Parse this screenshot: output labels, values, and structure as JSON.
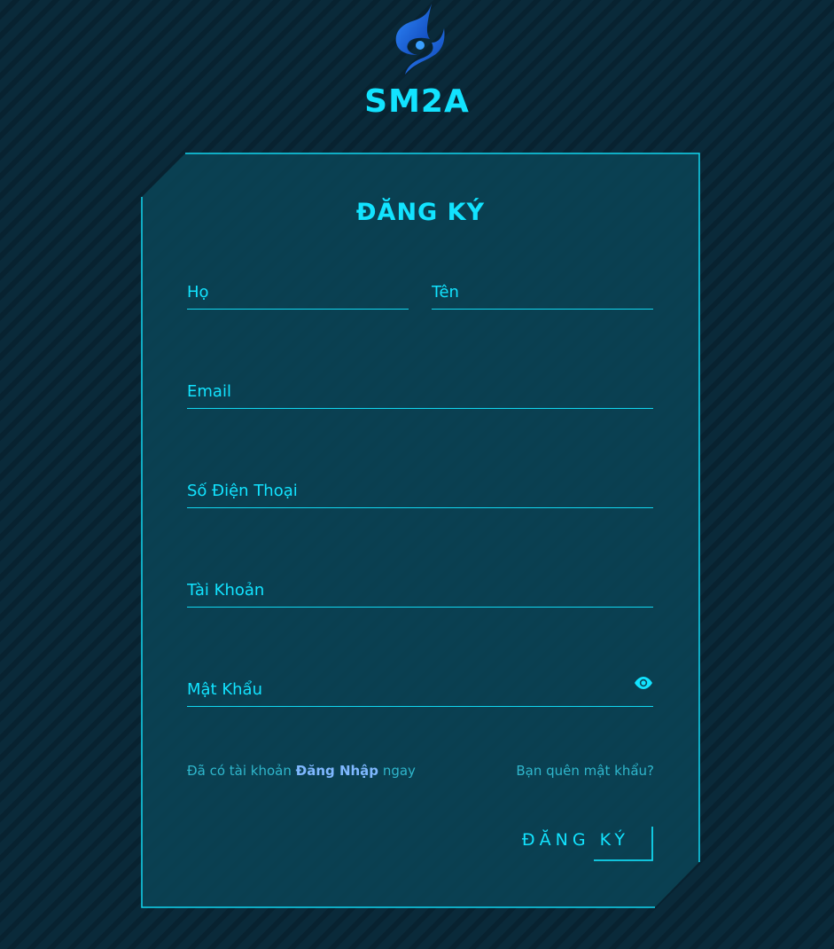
{
  "brand": {
    "name": "SM2A"
  },
  "form": {
    "title": "ĐĂNG KÝ",
    "fields": {
      "last_name": {
        "placeholder": "Họ",
        "value": ""
      },
      "first_name": {
        "placeholder": "Tên",
        "value": ""
      },
      "email": {
        "placeholder": "Email",
        "value": ""
      },
      "phone": {
        "placeholder": "Số Điện Thoại",
        "value": ""
      },
      "username": {
        "placeholder": "Tài Khoản",
        "value": ""
      },
      "password": {
        "placeholder": "Mật Khẩu",
        "value": ""
      }
    },
    "login_prompt": {
      "before": "Đã có tài khoản ",
      "link": "Đăng Nhập",
      "after": " ngay"
    },
    "forgot_password": "Bạn quên mật khẩu?",
    "submit_label": "ĐĂNG KÝ"
  },
  "icons": {
    "logo": "sm2a-logo",
    "password_toggle": "eye-icon"
  },
  "colors": {
    "accent": "#12e3ff",
    "background": "#0a2a3a",
    "card": "#0b4558",
    "link": "#7fb8ff"
  }
}
